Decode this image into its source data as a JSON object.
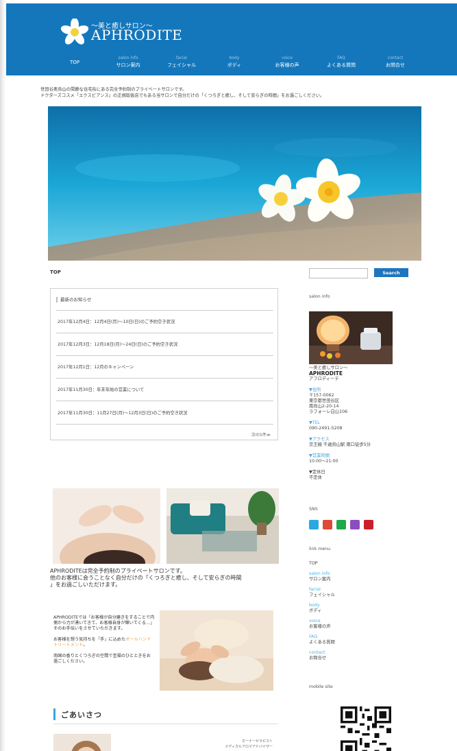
{
  "header": {
    "tagline": "〜美と癒しサロン〜",
    "brand": "APHRODITE",
    "colors": {
      "bar": "#1477bc"
    },
    "nav": [
      {
        "en": "",
        "jp": "TOP"
      },
      {
        "en": "salon info",
        "jp": "サロン案内"
      },
      {
        "en": "facial",
        "jp": "フェイシャル"
      },
      {
        "en": "body",
        "jp": "ボディ"
      },
      {
        "en": "voice",
        "jp": "お客様の声"
      },
      {
        "en": "FAQ",
        "jp": "よくある質問"
      },
      {
        "en": "contact",
        "jp": "お問合せ"
      }
    ]
  },
  "intro": {
    "line1": "世田谷奥烏山の閑静な住宅街にある完全予約制のプライベートサロンです。",
    "line2": "ドクターズコスメ「エクスビアンス」の正規取扱店でもある当サロンで自分だけの「くつろぎと癒し、そして安らぎの時間」をお過ごしください。"
  },
  "breadcrumb": "TOP",
  "search": {
    "placeholder": "",
    "button": "Search"
  },
  "news": {
    "title": "最新のお知らせ",
    "items": [
      "2017年12月4日：12月4日(月)〜10日(日)のご予約空き状況",
      "2017年12月3日：12月18日(月)〜24日(日)のご予約空き状況",
      "2017年12月1日：12月のキャンペーン",
      "2017年11月30日：年末年始の営業について",
      "2017年11月30日：11月27日(月)〜12月3日(日)のご予約空き状況"
    ],
    "more": "次の5件≫"
  },
  "sidebar": {
    "salon_info_head": "salon info",
    "tagline": "〜美と癒しサロン〜",
    "brand": "APHRODITE",
    "kana": "アフロディーテ",
    "address_label": "▼住所",
    "address": [
      "〒157-0062",
      "東京都世田谷区",
      "南烏山2-20-14",
      "ラフォーレ白山106"
    ],
    "tel_label": "▼TEL",
    "tel": "090-2491-5208",
    "access_label": "▼アクセス",
    "access": "京王線 千歳烏山駅 南口徒歩5分",
    "hours_label": "▼営業時間",
    "hours": "10:00〜21:00",
    "holiday_label": "▼定休日",
    "holiday": "不定休",
    "sns_head": "SNS",
    "sns": [
      {
        "icon": "twitter-icon",
        "color": "#2aa9e0",
        "glyph": "t"
      },
      {
        "icon": "google-plus-icon",
        "color": "#dc4a38",
        "glyph": "G+"
      },
      {
        "icon": "line-icon",
        "color": "#1fa84c",
        "glyph": "L"
      },
      {
        "icon": "instagram-icon",
        "color": "#8a4fbf",
        "glyph": "◎"
      },
      {
        "icon": "pinterest-icon",
        "color": "#cb2027",
        "glyph": "P"
      }
    ],
    "link_menu_head": "link menu",
    "links": [
      {
        "en": "",
        "jp": "TOP"
      },
      {
        "en": "salon info",
        "jp": "サロン案内"
      },
      {
        "en": "facial",
        "jp": "フェイシャル"
      },
      {
        "en": "body",
        "jp": "ボディ"
      },
      {
        "en": "voice",
        "jp": "お客様の声"
      },
      {
        "en": "FAQ",
        "jp": "よくある質問"
      },
      {
        "en": "contact",
        "jp": "お問合せ"
      }
    ],
    "mobile_head": "mobile site"
  },
  "lead": {
    "line1": "APHRODITEは完全予約制のプライベートサロンです。",
    "line2": "他のお客様に会うことなく自分だけの「くつろぎと癒し、そして安らぎの時間",
    "line3": "」をお過ごしいただけます。"
  },
  "body_text": {
    "p1": "APHRODITEでは「お客様が自分磨きをすることで内側から力が湧いてきて、お客様自身が輝いてくる…」そのお手伝いをさせていただきます。",
    "p2_before": "お客様を想う気持ちを「手」に込めた",
    "p2_link": "オールハンドトリートメント",
    "p2_after": "。",
    "p3": "南国の香りとくつろぎの空間で至福のひとときをお過ごしください。"
  },
  "greeting": {
    "title": "ごあいさつ",
    "owner_line1": "オーナーセラピスト",
    "owner_line2": "メディカルアロマアドバイザー"
  }
}
